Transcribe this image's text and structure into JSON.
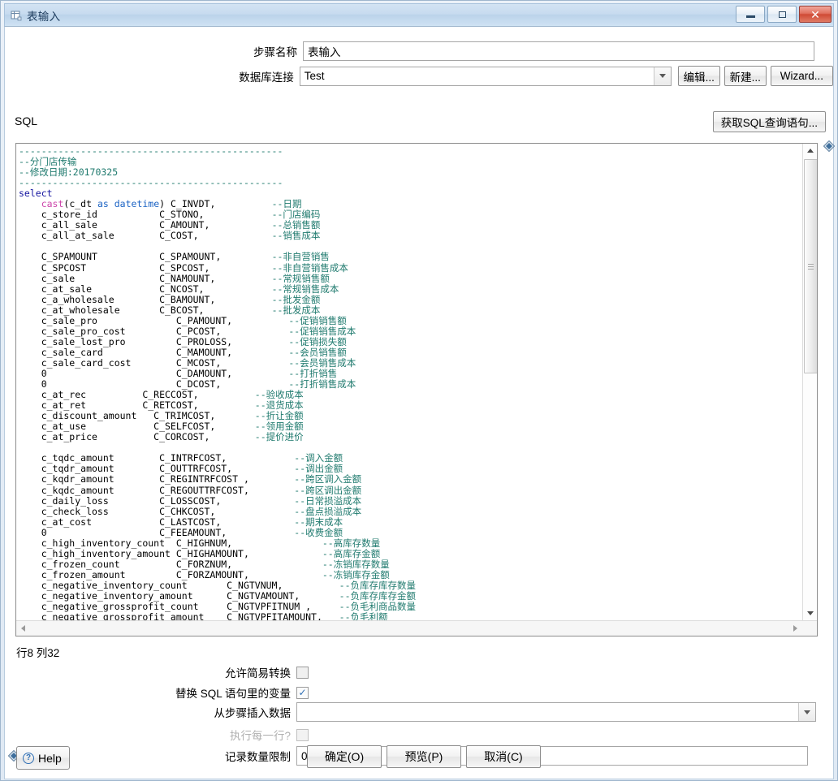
{
  "window": {
    "title": "表输入",
    "title_icon": "table-input-icon",
    "controls": {
      "minimize": "minimize-icon",
      "maximize": "maximize-icon",
      "close": "✕"
    }
  },
  "form": {
    "step_name_label": "步骤名称",
    "step_name_value": "表输入",
    "connection_label": "数据库连接",
    "connection_value": "Test",
    "edit_button": "编辑...",
    "new_button": "新建...",
    "wizard_button": "Wizard..."
  },
  "sql": {
    "section_label": "SQL",
    "get_sql_button": "获取SQL查询语句...",
    "status": "行8 列32",
    "code_lines": [
      "-----------------------------------------------",
      "--分门店传输",
      "--修改日期:20170325",
      "-----------------------------------------------",
      "select",
      "    cast(c_dt as datetime) C_INVDT,          --日期",
      "    c_store_id           C_STONO,            --门店编码",
      "    c_all_sale           C_AMOUNT,           --总销售额",
      "    c_all_at_sale        C_COST,             --销售成本",
      "",
      "    C_SPAMOUNT           C_SPAMOUNT,         --非自营销售",
      "    C_SPCOST             C_SPCOST,           --非自营销售成本",
      "    c_sale               C_NAMOUNT,          --常规销售额",
      "    c_at_sale            C_NCOST,            --常规销售成本",
      "    c_a_wholesale        C_BAMOUNT,          --批发金额",
      "    c_at_wholesale       C_BCOST,            --批发成本",
      "    c_sale_pro              C_PAMOUNT,         --促销销售额",
      "    c_sale_pro_cost         C_PCOST,           --促销销售成本",
      "    c_sale_lost_pro         C_PROLOSS,         --促销损失额",
      "    c_sale_card             C_MAMOUNT,         --会员销售额",
      "    c_sale_card_cost        C_MCOST,           --会员销售成本",
      "    0                       C_DAMOUNT,         --打折销售",
      "    0                       C_DCOST,           --打折销售成本",
      "    c_at_rec          C_RECCOST,          --验收成本",
      "    c_at_ret          C_RETCOST,          --退货成本",
      "    c_discount_amount   C_TRIMCOST,       --折让金额",
      "    c_at_use            C_SELFCOST,       --领用金额",
      "    c_at_price          C_CORCOST,        --提价进价",
      "",
      "    c_tqdc_amount        C_INTRFCOST,           --调入金额",
      "    c_tqdr_amount        C_OUTTRFCOST,          --调出金额",
      "    c_kqdr_amount        C_REGINTRFCOST ,       --跨区调入金额",
      "    c_kqdc_amount        C_REGOUTTRFCOST,       --跨区调出金额",
      "    c_daily_loss         C_LOSSCOST,            --日常损溢成本",
      "    c_check_loss         C_CHKCOST,             --盘点损溢成本",
      "    c_at_cost            C_LASTCOST,            --期末成本",
      "    0                    C_FEEAMOUNT,           --收费金额",
      "    c_high_inventory_count  C_HIGHNUM,               --高库存数量",
      "    c_high_inventory_amount C_HIGHAMOUNT,            --高库存金额",
      "    c_frozen_count          C_FORZNUM,               --冻销库存数量",
      "    c_frozen_amount         C_FORZAMOUNT,            --冻销库存金额",
      "    c_negative_inventory_count       C_NGTVNUM,         --负库存库存数量",
      "    c_negative_inventory_amount      C_NGTVAMOUNT,      --负库存库存金额",
      "    c_negative_grossprofit_count     C_NGTVPFITNUM ,    --负毛利商品数量",
      "    c_negative_grossprofit_amount    C_NGTVPFITAMOUNT,  --负毛利额"
    ]
  },
  "options": {
    "allow_simple_transform_label": "允许简易转换",
    "allow_simple_transform_checked": false,
    "replace_variables_label": "替换 SQL 语句里的变量",
    "replace_variables_checked": true,
    "insert_from_step_label": "从步骤插入数据",
    "insert_from_step_value": "",
    "execute_each_row_label": "执行每一行?",
    "execute_each_row_checked": false,
    "limit_label": "记录数量限制",
    "limit_value": "0"
  },
  "footer": {
    "help_label": "Help",
    "ok_label": "确定(O)",
    "preview_label": "预览(P)",
    "cancel_label": "取消(C)"
  },
  "colors": {
    "comment": "#1f7a6e",
    "keyword": "#1414a0",
    "function": "#cc44aa",
    "type": "#1b63c4",
    "title_text": "#1b3a5c",
    "close_button": "#cf4a35"
  }
}
